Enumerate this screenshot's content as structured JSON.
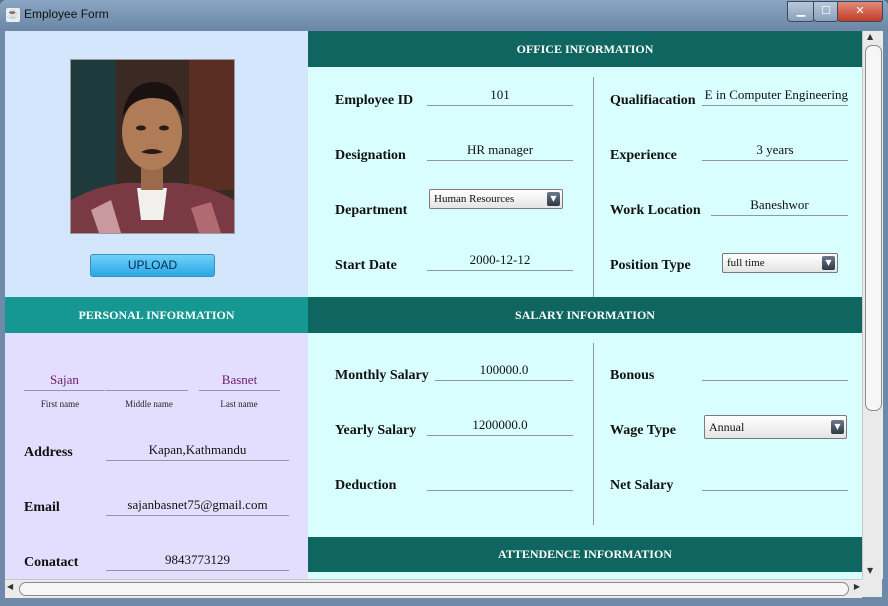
{
  "window": {
    "title": "Employee Form"
  },
  "photo_panel": {
    "upload_label": "UPLOAD"
  },
  "office": {
    "header": "OFFICE INFORMATION",
    "employee_id_label": "Employee ID",
    "employee_id": "101",
    "designation_label": "Designation",
    "designation": "HR manager",
    "department_label": "Department",
    "department": "Human Resources",
    "start_date_label": "Start Date",
    "start_date": "2000-12-12",
    "qualification_label": "Qualifiacation",
    "qualification": "E in Computer Engineering",
    "experience_label": "Experience",
    "experience": "3  years",
    "work_location_label": "Work Location",
    "work_location": "Baneshwor",
    "position_type_label": "Position Type",
    "position_type": "full time"
  },
  "personal": {
    "header": "PERSONAL INFORMATION",
    "first_name": "Sajan",
    "middle_name": "",
    "last_name": "Basnet",
    "first_name_caption": "First name",
    "middle_name_caption": "Middle name",
    "last_name_caption": "Last name",
    "address_label": "Address",
    "address": "Kapan,Kathmandu",
    "email_label": "Email",
    "email": "sajanbasnet75@gmail.com",
    "contact_label": "Conatact",
    "contact": "9843773129"
  },
  "salary": {
    "header": "SALARY INFORMATION",
    "monthly_label": "Monthly Salary",
    "monthly": "100000.0",
    "yearly_label": "Yearly Salary",
    "yearly": "1200000.0",
    "deduction_label": "Deduction",
    "deduction": "",
    "bonus_label": "Bonous",
    "bonus": "",
    "wage_type_label": "Wage Type",
    "wage_type": "Annual",
    "net_salary_label": "Net Salary",
    "net_salary": ""
  },
  "attendance": {
    "header": "ATTENDENCE INFORMATION"
  },
  "icons": {
    "app": "java-cup-icon",
    "arrow": "chevron-down-icon"
  }
}
